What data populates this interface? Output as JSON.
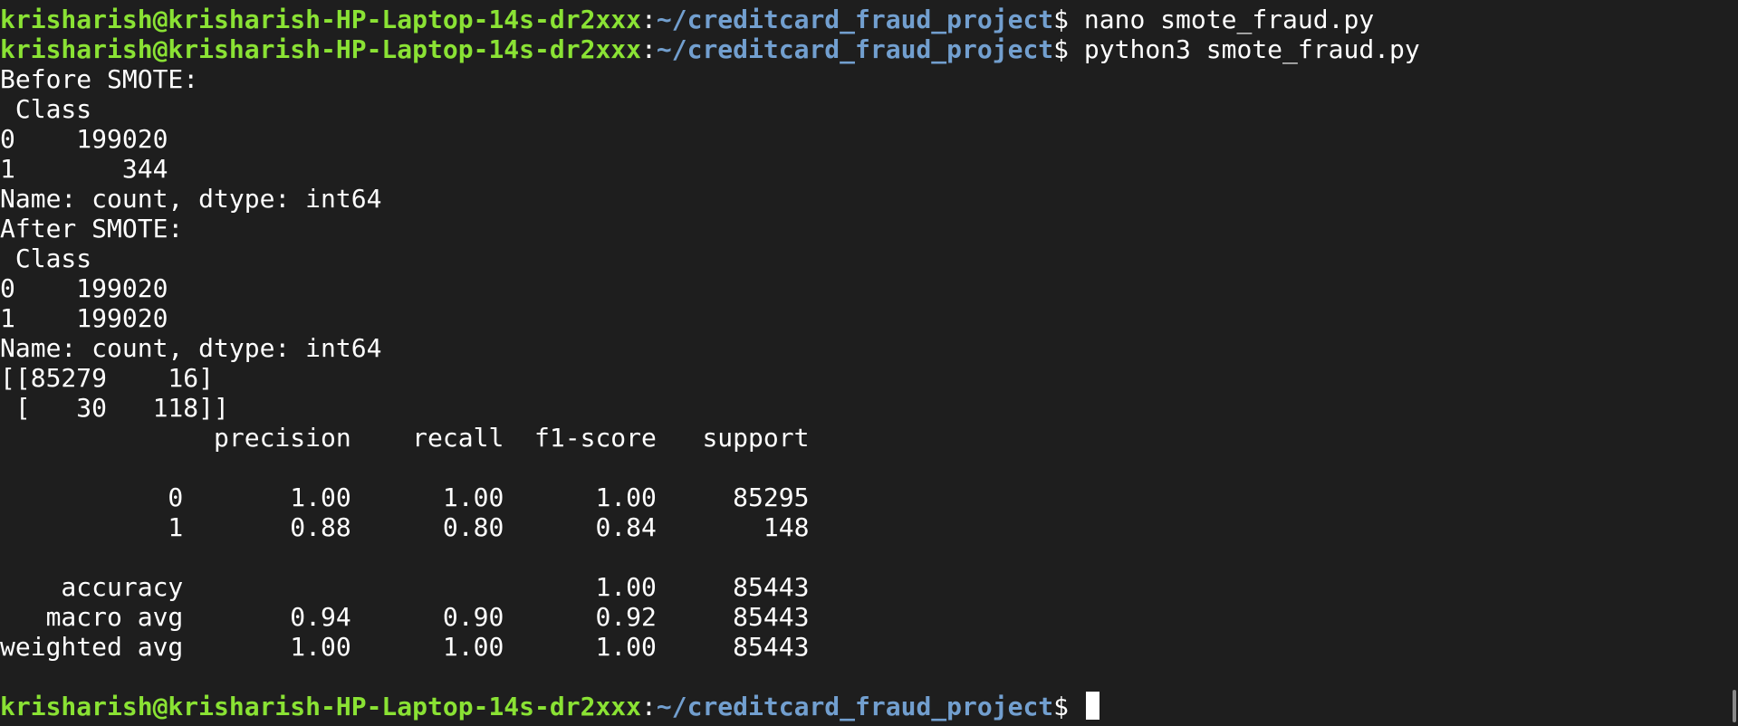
{
  "prompt": {
    "user_host": "krisharish@krisharish-HP-Laptop-14s-dr2xxx",
    "separator": ":",
    "path": "~/creditcard_fraud_project",
    "symbol": "$ "
  },
  "commands": [
    "nano smote_fraud.py",
    "python3 smote_fraud.py"
  ],
  "output": [
    "Before SMOTE:",
    " Class",
    "0    199020",
    "1       344",
    "Name: count, dtype: int64",
    "After SMOTE:",
    " Class",
    "0    199020",
    "1    199020",
    "Name: count, dtype: int64",
    "[[85279    16]",
    " [   30   118]]",
    "              precision    recall  f1-score   support",
    "",
    "           0       1.00      1.00      1.00     85295",
    "           1       0.88      0.80      0.84       148",
    "",
    "    accuracy                           1.00     85443",
    "   macro avg       0.94      0.90      0.92     85443",
    "weighted avg       1.00      1.00      1.00     85443",
    ""
  ],
  "colors": {
    "background": "#1e1e1e",
    "user_host": "#8ae234",
    "path": "#729fcf",
    "text": "#ffffff"
  }
}
